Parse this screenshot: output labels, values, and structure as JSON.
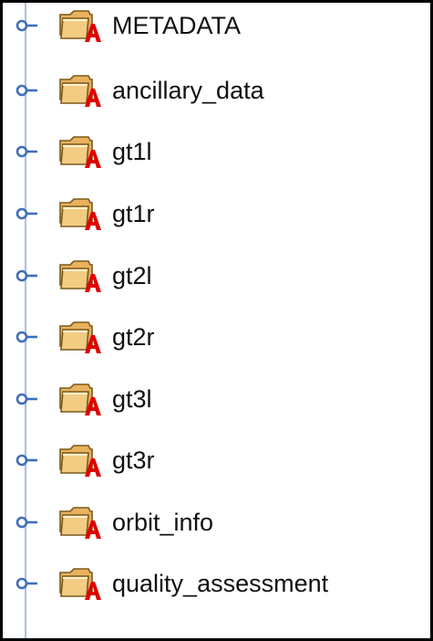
{
  "tree": {
    "items": [
      {
        "label": "METADATA",
        "icon": "attributed-group-folder-icon"
      },
      {
        "label": "ancillary_data",
        "icon": "attributed-group-folder-icon"
      },
      {
        "label": "gt1l",
        "icon": "attributed-group-folder-icon"
      },
      {
        "label": "gt1r",
        "icon": "attributed-group-folder-icon"
      },
      {
        "label": "gt2l",
        "icon": "attributed-group-folder-icon"
      },
      {
        "label": "gt2r",
        "icon": "attributed-group-folder-icon"
      },
      {
        "label": "gt3l",
        "icon": "attributed-group-folder-icon"
      },
      {
        "label": "gt3r",
        "icon": "attributed-group-folder-icon"
      },
      {
        "label": "orbit_info",
        "icon": "attributed-group-folder-icon"
      },
      {
        "label": "quality_assessment",
        "icon": "attributed-group-folder-icon"
      }
    ]
  },
  "colors": {
    "border": "#000000",
    "tree_line": "#a9bfdc",
    "connector": "#3f6fb8",
    "folder_fill": "#f2cc82",
    "folder_outline": "#7a5a1c",
    "attribute_badge": "#e00000"
  }
}
